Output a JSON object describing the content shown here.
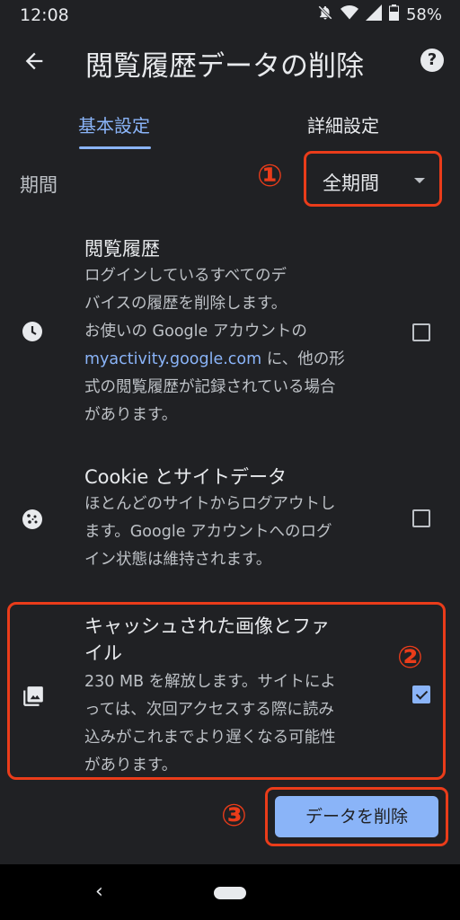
{
  "status_bar": {
    "time": "12:08",
    "battery": "58%",
    "icons": [
      "dnd-off-icon",
      "wifi-icon",
      "signal-icon",
      "battery-icon"
    ]
  },
  "app_bar": {
    "title": "閲覧履歴データの削除",
    "back_icon": "arrow-back-icon",
    "help_icon": "help-icon"
  },
  "tabs": [
    {
      "label": "基本設定",
      "active": true
    },
    {
      "label": "詳細設定",
      "active": false
    }
  ],
  "time_range": {
    "label": "期間",
    "selected": "全期間"
  },
  "markers": {
    "one": "①",
    "two": "②",
    "three": "③"
  },
  "items": [
    {
      "icon": "clock-icon",
      "title": "閲覧履歴",
      "desc_lines": [
        "ログインしているすべてのデ",
        "バイスの履歴を削除します。",
        "お使いの Google アカウントの"
      ],
      "link": "myactivity.google.com",
      "link_suffix": " に、他の形",
      "desc_lines_after": [
        "式の閲覧履歴が記録されている場合",
        "があります。"
      ],
      "checked": false
    },
    {
      "icon": "cookie-icon",
      "title": "Cookie とサイトデータ",
      "desc_lines": [
        "ほとんどのサイトからログアウトし",
        "ます。Google アカウントへのログ",
        "イン状態は維持されます。"
      ],
      "checked": false
    },
    {
      "icon": "image-icon",
      "title_lines": [
        "キャッシュされた画像とファ",
        "イル"
      ],
      "desc_lines": [
        "230 MB を解放します。サイトによ",
        "っては、次回アクセスする際に読み",
        "込みがこれまでより遅くなる可能性",
        "があります。"
      ],
      "checked": true
    }
  ],
  "delete_button": {
    "label": "データを削除"
  },
  "nav": {
    "back": "‹"
  },
  "colors": {
    "background": "#202124",
    "accent": "#8ab4f8",
    "annotation": "#ea3c1a"
  }
}
